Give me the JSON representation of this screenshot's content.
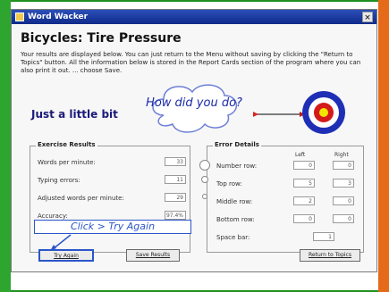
{
  "window": {
    "title": "Word Wacker",
    "close_label": "×"
  },
  "heading": "Bicycles: Tire Pressure",
  "description": "Your results are displayed below. You can just return to the Menu without saving by clicking the \"Return to Topics\" button. All the information below is stored in the Report Cards section of the program where you can also print it out. ... choose Save.",
  "praise": "Just a little bit",
  "bubble_text": "How did you do?",
  "exercise": {
    "legend": "Exercise Results",
    "rows": [
      {
        "label": "Words per minute:",
        "value": "33"
      },
      {
        "label": "Typing errors:",
        "value": "11"
      },
      {
        "label": "Adjusted words per minute:",
        "value": "29"
      },
      {
        "label": "Accuracy:",
        "value": "97.4%"
      }
    ]
  },
  "errors": {
    "legend": "Error Details",
    "left_label": "Left",
    "right_label": "Right",
    "rows": [
      {
        "label": "Number row:",
        "left": "0",
        "right": "0"
      },
      {
        "label": "Top row:",
        "left": "5",
        "right": "3"
      },
      {
        "label": "Middle row:",
        "left": "2",
        "right": "0"
      },
      {
        "label": "Bottom row:",
        "left": "0",
        "right": "0"
      }
    ],
    "space": {
      "label": "Space bar:",
      "value": "1"
    }
  },
  "callout": "Click > Try Again",
  "buttons": {
    "try_again": "Try Again",
    "save": "Save Results",
    "return": "Return to Topics"
  },
  "colors": {
    "accent": "#2b56c9",
    "green": "#2ea52e",
    "orange": "#e56b1a"
  }
}
